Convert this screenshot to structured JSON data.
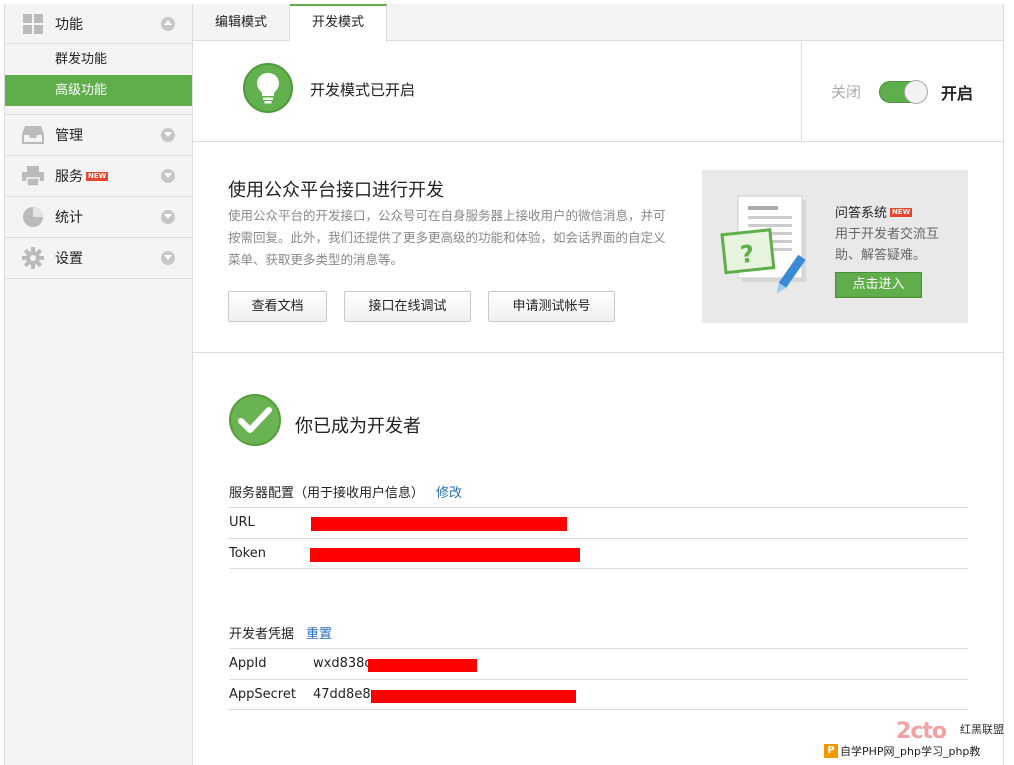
{
  "sidebar": {
    "groups": [
      {
        "label": "功能",
        "icon": "grid-icon",
        "expanded": true,
        "items": [
          {
            "label": "群发功能"
          },
          {
            "label": "高级功能",
            "active": true
          }
        ]
      },
      {
        "label": "管理",
        "icon": "inbox-icon"
      },
      {
        "label": "服务",
        "icon": "printer-icon",
        "badge": "NEW"
      },
      {
        "label": "统计",
        "icon": "pie-chart-icon"
      },
      {
        "label": "设置",
        "icon": "gear-icon"
      }
    ]
  },
  "tabs": [
    {
      "label": "编辑模式"
    },
    {
      "label": "开发模式",
      "active": true
    }
  ],
  "status": {
    "text": "开发模式已开启",
    "toggle_off": "关闭",
    "toggle_on": "开启",
    "enabled": true
  },
  "intro": {
    "title": "使用公众平台接口进行开发",
    "desc": "使用公众平台的开发接口，公众号可在自身服务器上接收用户的微信消息，并可按需回复。此外，我们还提供了更多更高级的功能和体验，如会话界面的自定义菜单、获取更多类型的消息等。",
    "buttons": [
      "查看文档",
      "接口在线调试",
      "申请测试帐号"
    ]
  },
  "promo": {
    "title": "问答系统",
    "badge": "NEW",
    "desc": "用于开发者交流互助、解答疑难。",
    "button": "点击进入"
  },
  "developer": {
    "title": "你已成为开发者",
    "server_config": {
      "title": "服务器配置（用于接收用户信息）",
      "edit_link": "修改",
      "rows": [
        {
          "key": "URL",
          "value": ""
        },
        {
          "key": "Token",
          "value": ""
        }
      ]
    },
    "credentials": {
      "title": "开发者凭据",
      "reset_link": "重置",
      "rows": [
        {
          "key": "AppId",
          "value": "wxd838c"
        },
        {
          "key": "AppSecret",
          "value": "47dd8e8"
        }
      ]
    }
  },
  "watermark": {
    "logo": "2cto",
    "site": "红黑联盟",
    "bar_badge": "P",
    "bar_text": "自学PHP网_php学习_php教"
  },
  "colors": {
    "accent": "#5fae4b",
    "link": "#2a6fb8",
    "redaction": "#ff0000",
    "new_badge": "#e6452e"
  }
}
